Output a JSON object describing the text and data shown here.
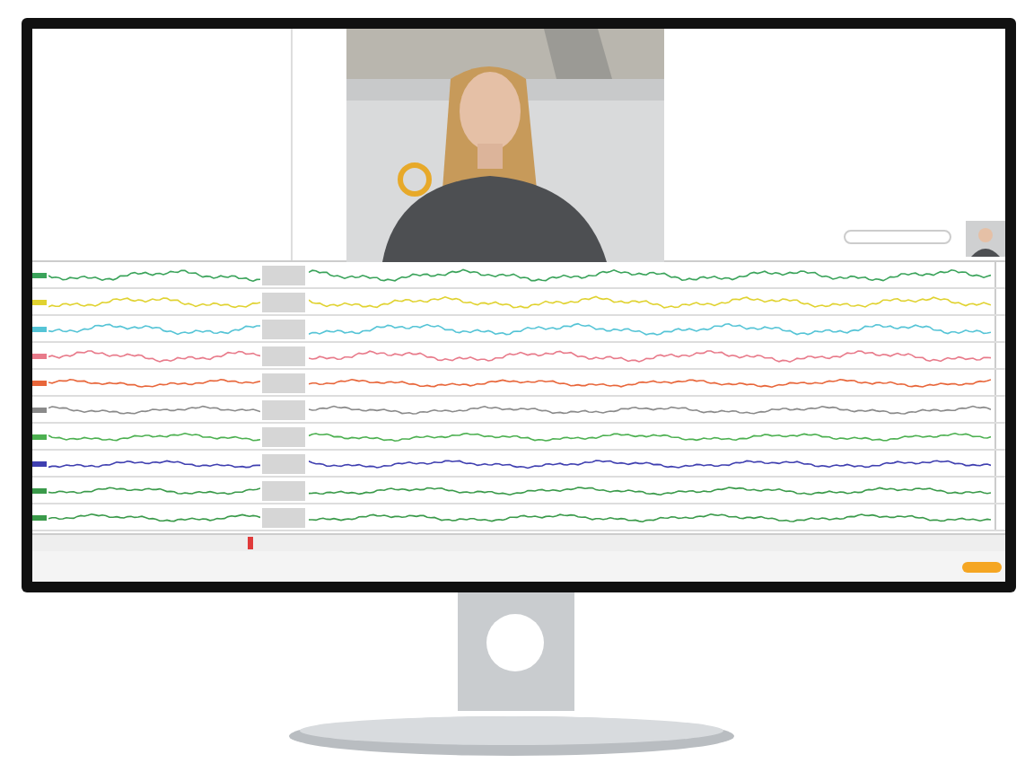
{
  "channels": [
    {
      "color": "#3aa35a"
    },
    {
      "color": "#e0d230"
    },
    {
      "color": "#55c4d6"
    },
    {
      "color": "#e87a8a"
    },
    {
      "color": "#e8663a"
    },
    {
      "color": "#8a8a8a"
    },
    {
      "color": "#4cb050"
    },
    {
      "color": "#3f3fb0"
    },
    {
      "color": "#3a9a4a"
    },
    {
      "color": "#3a9a4a"
    }
  ]
}
